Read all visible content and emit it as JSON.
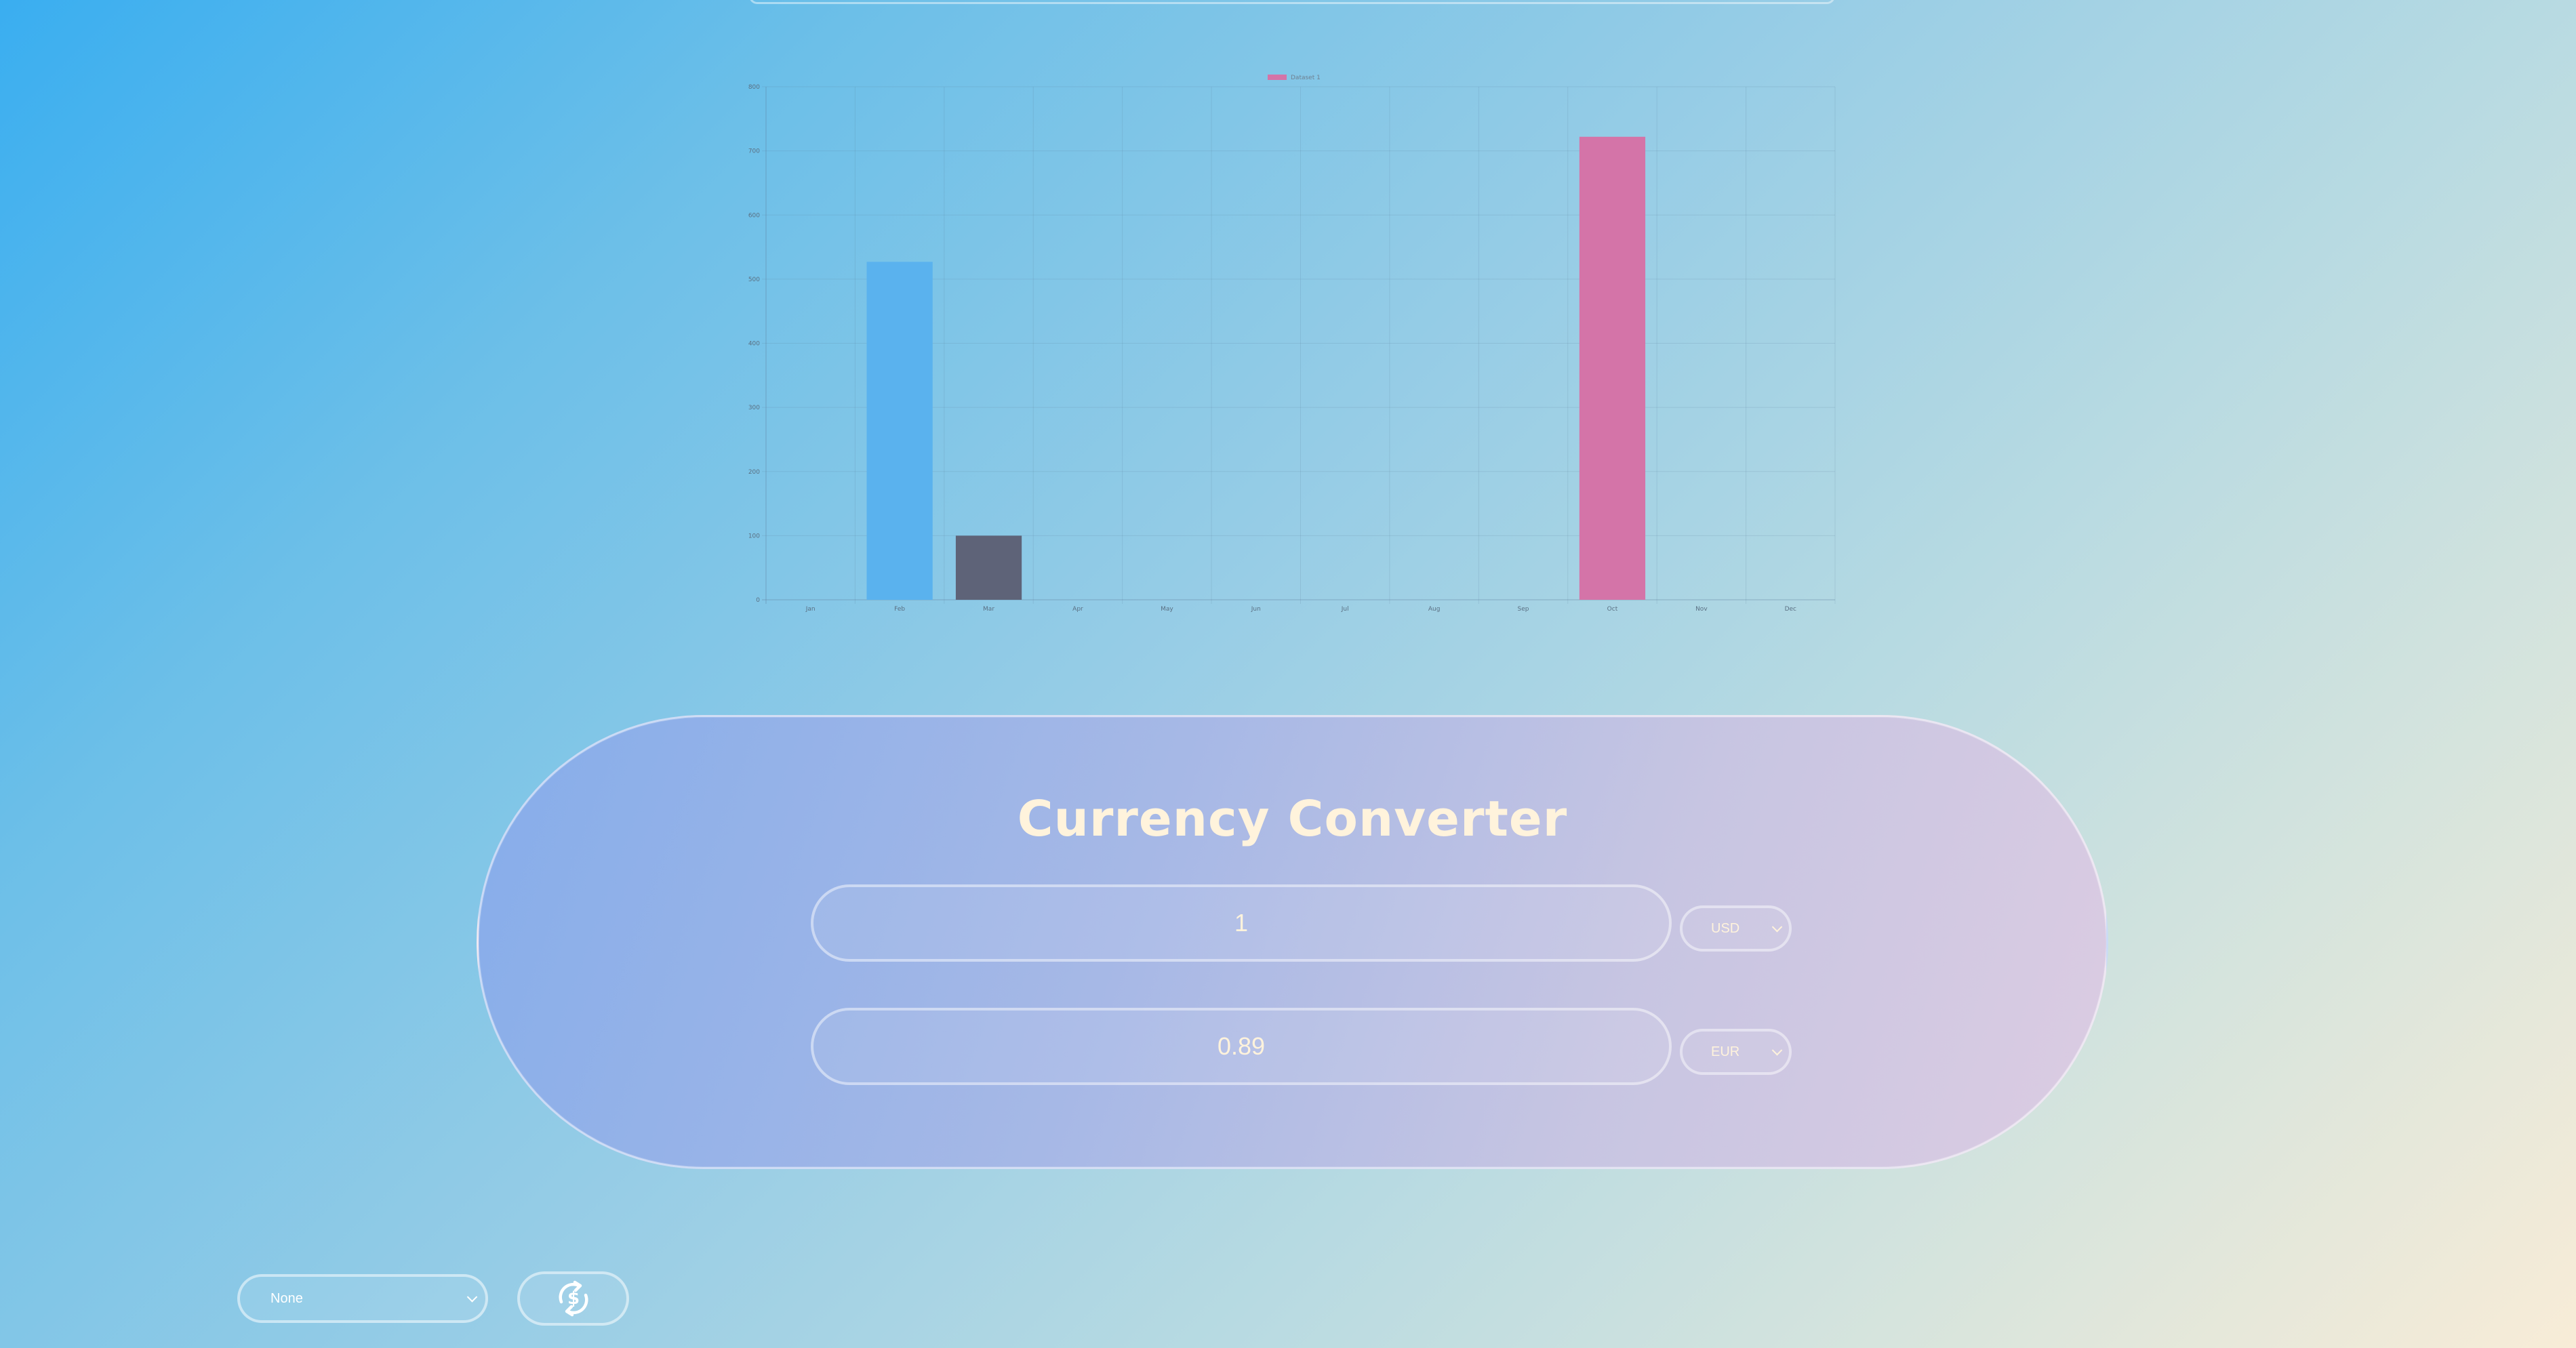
{
  "chart_data": {
    "type": "bar",
    "categories": [
      "Jan",
      "Feb",
      "Mar",
      "Apr",
      "May",
      "Jun",
      "Jul",
      "Aug",
      "Sep",
      "Oct",
      "Nov",
      "Dec"
    ],
    "values": [
      0,
      527,
      100,
      0,
      0,
      0,
      0,
      0,
      0,
      722,
      0,
      0
    ],
    "bar_colors": [
      "#5ab2ee",
      "#5ab2ee",
      "#5e6378",
      "#5ab2ee",
      "#5ab2ee",
      "#5ab2ee",
      "#5ab2ee",
      "#5ab2ee",
      "#5ab2ee",
      "#d474a8",
      "#5ab2ee",
      "#5ab2ee"
    ],
    "series": [
      {
        "name": "Dataset 1",
        "color": "#d474a8"
      }
    ],
    "ylim": [
      0,
      800
    ],
    "yticks": [
      "0",
      "100",
      "200",
      "300",
      "400",
      "500",
      "600",
      "700",
      "800"
    ],
    "grid": true,
    "legend_position": "top"
  },
  "converter": {
    "title": "Currency Converter",
    "from_amount": "1",
    "from_currency": "USD",
    "to_amount": "0.89",
    "to_currency": "EUR"
  },
  "controls": {
    "select_value": "None",
    "refresh_icon": "currency-exchange-icon"
  },
  "colors": {
    "title_text": "#fff3dc",
    "panel_border": "#ffffff"
  }
}
